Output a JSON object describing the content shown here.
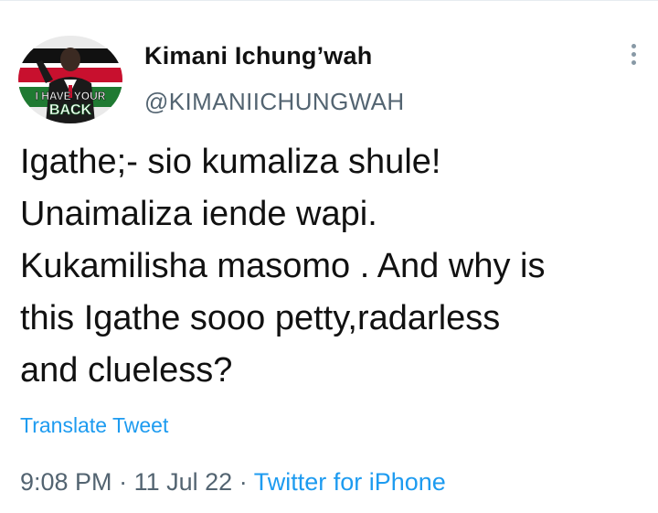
{
  "tweet": {
    "author_name": "Kimani Ichung’wah",
    "author_handle": "@KIMANIICHUNGWAH",
    "avatar": {
      "icon": "profile-photo",
      "banner_text_top": "I HAVE YOUR",
      "banner_text_bottom": "BACK"
    },
    "more_icon": "more-vertical-icon",
    "text_lines": [
      "Igathe;- sio kumaliza shule!",
      "Unaimaliza iende wapi.",
      "Kukamilisha masomo . And why is",
      "this Igathe sooo petty,radarless",
      "and clueless?"
    ],
    "translate_label": "Translate Tweet",
    "time": "9:08 PM",
    "separator": "·",
    "date": "11 Jul 22",
    "source": "Twitter for iPhone"
  },
  "colors": {
    "link": "#1d9bf0",
    "secondary_text": "#536471",
    "primary_text": "#111111"
  }
}
